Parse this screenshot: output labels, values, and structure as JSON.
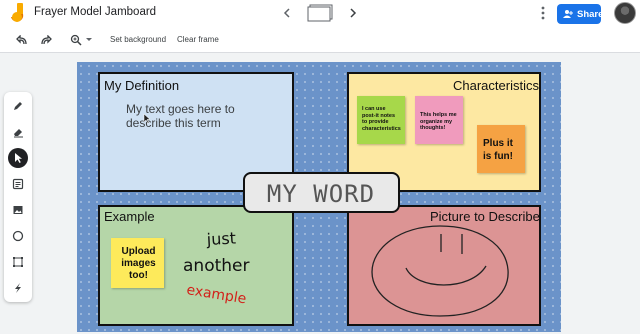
{
  "header": {
    "title": "Frayer Model Jamboard",
    "frame_icon": "frame-thumbnail-icon",
    "share_label": "Share"
  },
  "toolbar": {
    "set_background": "Set background",
    "clear_frame": "Clear frame"
  },
  "rail": {
    "tools": [
      "pen-icon",
      "eraser-icon",
      "select-icon",
      "sticky-note-icon",
      "image-icon",
      "circle-icon",
      "text-box-icon",
      "laser-icon"
    ],
    "active": "select-icon"
  },
  "board": {
    "definition": {
      "title": "My Definition",
      "body_line1": "My text goes here to",
      "body_line2": "describe this term"
    },
    "characteristics": {
      "title": "Characteristics",
      "note_green": "I can use post-it notes to provide characteristics",
      "note_pink": "This helps me organize my thoughts!",
      "note_orange": "Plus it is fun!"
    },
    "example": {
      "title": "Example",
      "note_yellow": "Upload images too!",
      "handwriting_1": "just",
      "handwriting_2": "another",
      "handwriting_3": "example"
    },
    "picture": {
      "title": "Picture to Describe"
    },
    "center_word": "MY WORD"
  },
  "colors": {
    "share_blue": "#1a73e8",
    "board_blue": "#6b93c9",
    "definition_bg": "#cfe1f3",
    "characteristics_bg": "#fde8a2",
    "example_bg": "#b5d6a8",
    "picture_bg": "#dc9494",
    "example_red": "#d3211a"
  }
}
